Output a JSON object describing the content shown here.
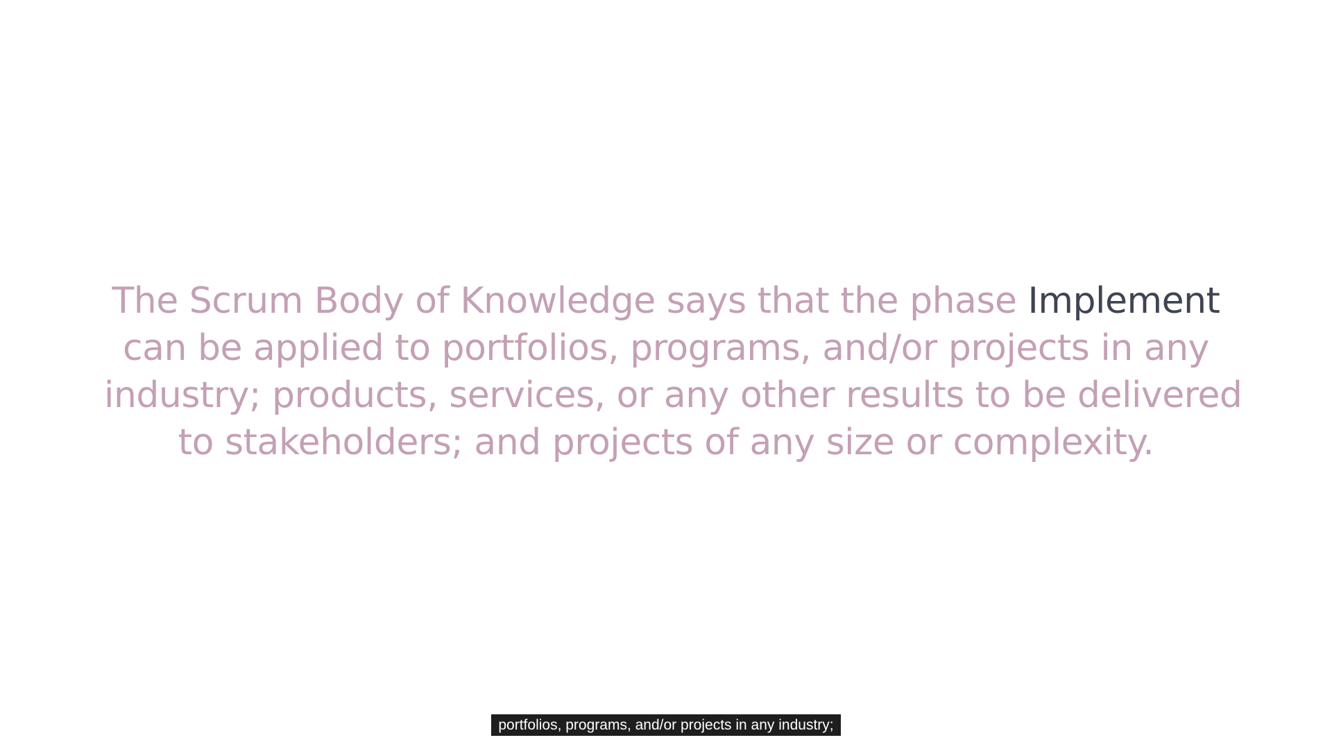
{
  "slide": {
    "lines": [
      {
        "before": "The Scrum Body of Knowledge says that the phase ",
        "highlight": "Implement"
      },
      {
        "text": "can be applied to portfolios, programs, and/or projects in any"
      },
      {
        "text": "industry; products, services, or any other results to be delivered"
      },
      {
        "text": "to stakeholders; and projects of any size or complexity."
      }
    ]
  },
  "subtitle": {
    "text": "portfolios, programs, and/or projects in any industry;"
  },
  "colors": {
    "background": "#ffffff",
    "body_text": "#c4a0b5",
    "highlight_text": "#3e4452",
    "subtitle_bg": "#1e1e1e",
    "subtitle_text": "#ffffff"
  }
}
